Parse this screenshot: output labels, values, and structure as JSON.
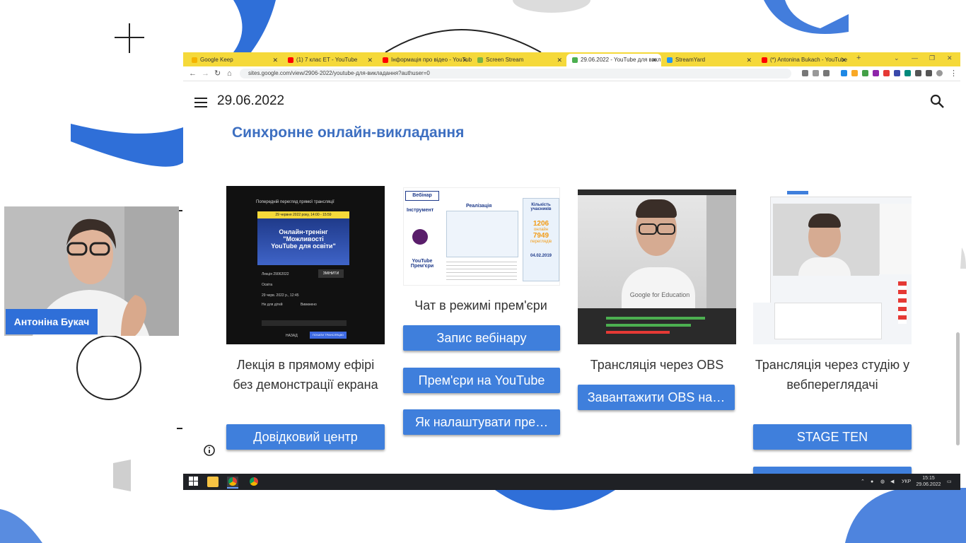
{
  "webcam": {
    "name": "Антоніна Букач"
  },
  "browser": {
    "tabs": [
      {
        "label": "Google Keep",
        "color": "#f4b400"
      },
      {
        "label": "(1) 7 клас ЕТ - YouTube",
        "color": "#ff0000"
      },
      {
        "label": "Інформація про відео - YouTub",
        "color": "#ff0000"
      },
      {
        "label": "Screen Stream",
        "color": "#7cb342"
      },
      {
        "label": "29.06.2022 - YouTube для викл",
        "color": "#4caf50"
      },
      {
        "label": "StreamYard",
        "color": "#2196f3"
      },
      {
        "label": "(*) Antonina Bukach - YouTube",
        "color": "#ff0000"
      }
    ],
    "url": "sites.google.com/view/2906-2022/youtube-для-викладання?authuser=0"
  },
  "page": {
    "date": "29.06.2022",
    "section_title": "Синхронне онлайн-викладання",
    "cards": [
      {
        "caption": "Лекція в прямому ефірі без демонстрації екрана",
        "thumb": {
          "header": "Попередній перегляд прямої трансляції",
          "date_line": "29 червня 2022 року, 14:00 - 15:59",
          "title1": "Онлайн-тренінг",
          "title2": "\"Можливості",
          "title3": "YouTube для освіти\"",
          "field1": "Лекція 29062022",
          "btn": "ЗМІНИТИ",
          "field2": "Освіта",
          "field3": "29 черв. 2022 р., 12:45",
          "field4": "Не для дітей",
          "field5": "Вимкнено",
          "footer": "НАЗАД",
          "footer_btn": "ПОЧАТИ ТРАНСЛЯЦІЮ"
        },
        "buttons": [
          "Довідковий центр"
        ]
      },
      {
        "caption": "Чат в режимі прем'єри",
        "thumb": {
          "webinar": "Вебінар",
          "instrument": "Інструмент",
          "realization": "Реалізація",
          "count_label": "Кількість учасників",
          "online_num": "1206",
          "online_label": "онлайн",
          "views_num": "7949",
          "views_label": "переглядів",
          "yt": "YouTube Прем'єри",
          "date": "04.02.2019"
        },
        "buttons": [
          "Запис вебінару",
          "Прем'єри на YouTube",
          "Як налаштувати пре…"
        ]
      },
      {
        "caption": "Трансляція через OBS",
        "thumb": {
          "shirt": "Google for Education"
        },
        "buttons": [
          "Завантажити OBS на…"
        ]
      },
      {
        "caption": "Трансляція через студію у вебпереглядачі",
        "thumb": {},
        "buttons": [
          "STAGE TEN",
          ""
        ]
      }
    ]
  },
  "taskbar": {
    "lang": "УКР",
    "time": "15:15",
    "date": "29.06.2022"
  }
}
